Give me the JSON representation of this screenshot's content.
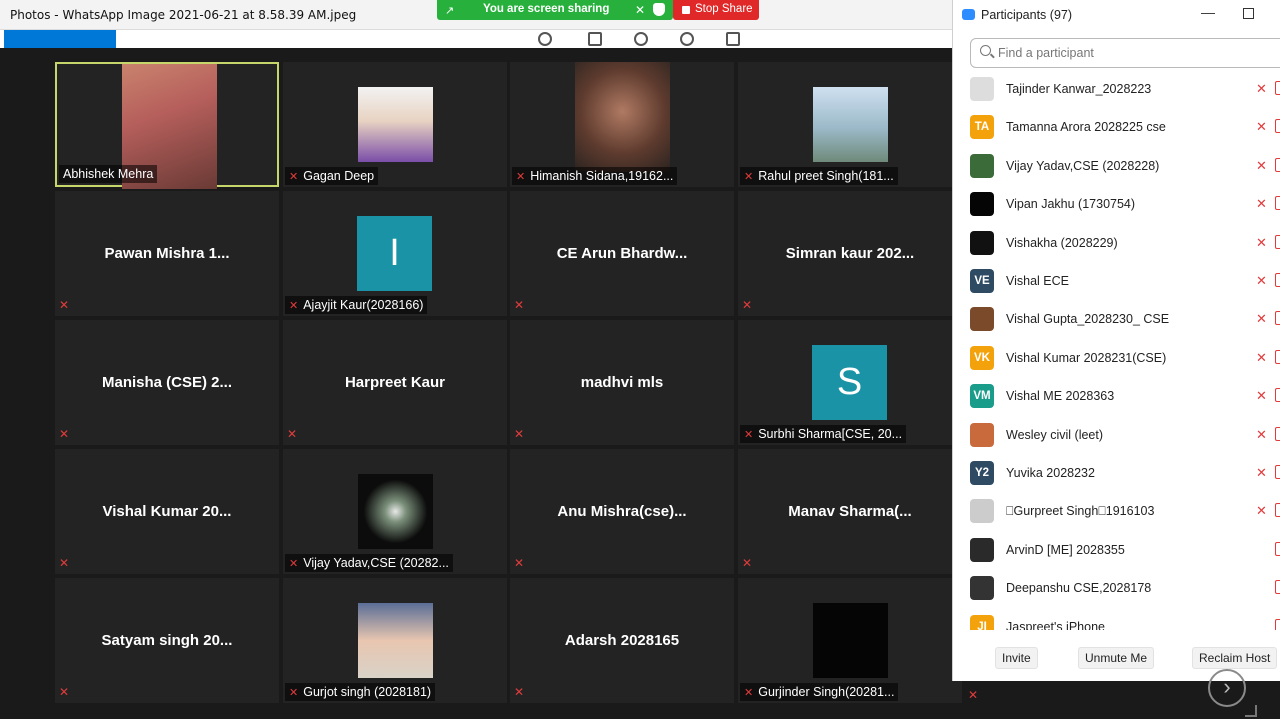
{
  "photos_app": {
    "title": "Photos - WhatsApp Image 2021-06-21 at 8.58.39 AM.jpeg"
  },
  "share_banner": {
    "text": "You are screen sharing",
    "stop_label": "Stop Share"
  },
  "gallery": {
    "tiles": [
      {
        "name": "Abhishek Mehra",
        "big": "",
        "muted": false,
        "kind": "photo",
        "active": true
      },
      {
        "name": "Gagan Deep",
        "big": "",
        "muted": true,
        "kind": "photo"
      },
      {
        "name": "Himanish Sidana,19162...",
        "big": "",
        "muted": true,
        "kind": "photo"
      },
      {
        "name": "Rahul preet Singh(181...",
        "big": "",
        "muted": true,
        "kind": "photo"
      },
      {
        "name": "",
        "big": "Pawan Mishra 1...",
        "muted": true,
        "kind": "text"
      },
      {
        "name": "Ajayjit Kaur(2028166)",
        "big": "",
        "muted": true,
        "kind": "letter",
        "letter": "I"
      },
      {
        "name": "",
        "big": "CE Arun Bhardw...",
        "muted": true,
        "kind": "text"
      },
      {
        "name": "",
        "big": "Simran kaur 202...",
        "muted": true,
        "kind": "text"
      },
      {
        "name": "",
        "big": "Manisha (CSE) 2...",
        "muted": true,
        "kind": "text"
      },
      {
        "name": "",
        "big": "Harpreet Kaur",
        "muted": true,
        "kind": "text"
      },
      {
        "name": "",
        "big": "madhvi mls",
        "muted": true,
        "kind": "text"
      },
      {
        "name": "Surbhi Sharma[CSE, 20...",
        "big": "",
        "muted": true,
        "kind": "letter",
        "letter": "S"
      },
      {
        "name": "",
        "big": "Vishal Kumar 20...",
        "muted": true,
        "kind": "text"
      },
      {
        "name": "Vijay Yadav,CSE (20282...",
        "big": "",
        "muted": true,
        "kind": "photo"
      },
      {
        "name": "",
        "big": "Anu Mishra(cse)...",
        "muted": true,
        "kind": "text"
      },
      {
        "name": "",
        "big": "Manav Sharma(...",
        "muted": true,
        "kind": "text"
      },
      {
        "name": "",
        "big": "Satyam singh 20...",
        "muted": true,
        "kind": "text"
      },
      {
        "name": "Gurjot singh (2028181)",
        "big": "",
        "muted": true,
        "kind": "photo"
      },
      {
        "name": "",
        "big": "Adarsh 2028165",
        "muted": true,
        "kind": "text"
      },
      {
        "name": "Gurjinder Singh(20281...",
        "big": "",
        "muted": true,
        "kind": "photo"
      }
    ]
  },
  "participants_panel": {
    "title": "Participants (97)",
    "search_placeholder": "Find a participant",
    "participants": [
      {
        "name": "Tajinder Kanwar_2028223",
        "initials": "",
        "color": "#dddddd",
        "muted": true
      },
      {
        "name": "Tamanna Arora 2028225 cse",
        "initials": "TA",
        "color": "#f4a20b",
        "muted": true
      },
      {
        "name": "Vijay Yadav,CSE (2028228)",
        "initials": "",
        "color": "#3c6b3a",
        "muted": true
      },
      {
        "name": "Vipan Jakhu (1730754)",
        "initials": "",
        "color": "#050505",
        "muted": true
      },
      {
        "name": "Vishakha (2028229)",
        "initials": "",
        "color": "#111111",
        "muted": true
      },
      {
        "name": "Vishal ECE",
        "initials": "VE",
        "color": "#2e4b63",
        "muted": true
      },
      {
        "name": "Vishal Gupta_2028230_ CSE",
        "initials": "",
        "color": "#7a4a2a",
        "muted": true
      },
      {
        "name": "Vishal Kumar 2028231(CSE)",
        "initials": "VK",
        "color": "#f4a20b",
        "muted": true
      },
      {
        "name": "Vishal ME 2028363",
        "initials": "VM",
        "color": "#1a9c8a",
        "muted": true
      },
      {
        "name": "Wesley civil (leet)",
        "initials": "",
        "color": "#c86a3c",
        "muted": true
      },
      {
        "name": "Yuvika 2028232",
        "initials": "Y2",
        "color": "#2e4b63",
        "muted": true
      },
      {
        "name": "⎕Gurpreet Singh⎕1916103",
        "initials": "",
        "color": "#cccccc",
        "muted": true
      },
      {
        "name": "ArvinD [ME] 2028355",
        "initials": "",
        "color": "#2a2a2a",
        "muted": false
      },
      {
        "name": "Deepanshu CSE,2028178",
        "initials": "",
        "color": "#333333",
        "muted": false
      },
      {
        "name": "Jaspreet's iPhone",
        "initials": "JI",
        "color": "#f4a20b",
        "muted": false
      }
    ],
    "buttons": {
      "invite": "Invite",
      "unmute_me": "Unmute Me",
      "reclaim_host": "Reclaim Host"
    }
  }
}
